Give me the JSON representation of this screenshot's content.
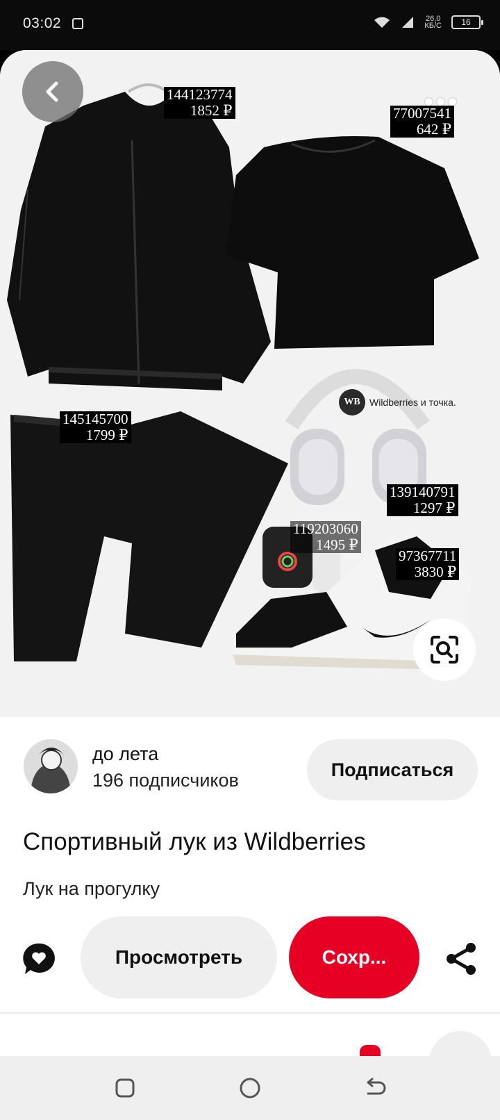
{
  "status_bar": {
    "time": "03:02",
    "network_speed": "26,0\nКБ/С",
    "battery": "16"
  },
  "pin": {
    "price_tags": [
      {
        "article": "144123774",
        "price": "1852 ₽"
      },
      {
        "article": "77007541",
        "price": "642 ₽"
      },
      {
        "article": "145145700",
        "price": "1799 ₽"
      },
      {
        "article": "139140791",
        "price": "1297 ₽"
      },
      {
        "article": "119203060",
        "price": "1495 ₽"
      },
      {
        "article": "97367711",
        "price": "3830 ₽"
      }
    ],
    "watermark": {
      "logo_text": "WB",
      "text": "Wildberries и точка."
    }
  },
  "creator": {
    "name": "до лета",
    "subscribers": "196 подписчиков",
    "follow_label": "Подписаться"
  },
  "title": "Спортивный лук из Wildberries",
  "description": "Лук на прогулку",
  "actions": {
    "view_label": "Просмотреть",
    "save_label": "Сохр..."
  },
  "icons": {
    "back": "chevron-left-icon",
    "more": "more-dots-icon",
    "visual_search": "lens-search-icon",
    "comment": "comment-heart-icon",
    "share": "share-icon",
    "nav_recents": "recents-icon",
    "nav_home": "home-icon",
    "nav_back": "back-arrow-icon"
  },
  "colors": {
    "save_button": "#e60023",
    "secondary_button": "#efefef"
  }
}
